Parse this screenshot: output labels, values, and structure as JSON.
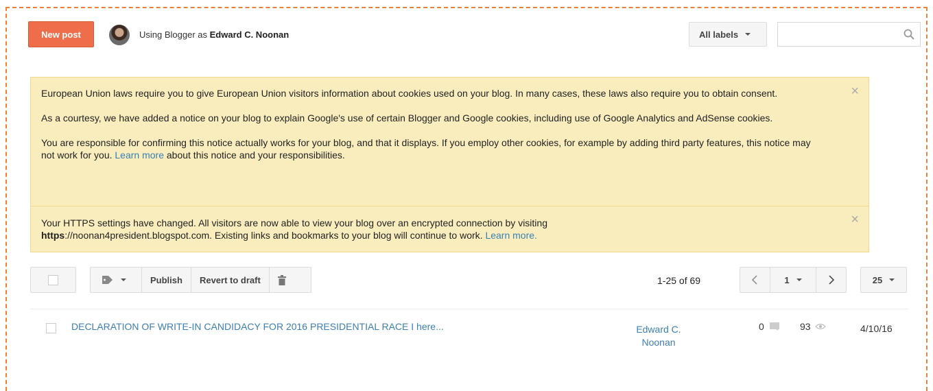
{
  "header": {
    "new_post_label": "New post",
    "using_prefix": "Using Blogger as",
    "user_name": "Edward C. Noonan",
    "labels_dropdown": "All labels",
    "search_placeholder": ""
  },
  "notices": {
    "eu": {
      "p1": "European Union laws require you to give European Union visitors information about cookies used on your blog. In many cases, these laws also require you to obtain consent.",
      "p2": "As a courtesy, we have added a notice on your blog to explain Google's use of certain Blogger and Google cookies, including use of Google Analytics and AdSense cookies.",
      "p3_before": "You are responsible for confirming this notice actually works for your blog, and that it displays. If you employ other cookies, for example by adding third party features, this notice may not work for you.",
      "p3_link": "Learn more",
      "p3_after": "about this notice and your responsibilities."
    },
    "https": {
      "text_before": "Your HTTPS settings have changed. All visitors are now able to view your blog over an encrypted connection by visiting",
      "https_bold": "https",
      "url_rest": "://noonan4president.blogspot.com. Existing links and bookmarks to your blog will continue to work.",
      "link": "Learn more."
    },
    "close_glyph": "×"
  },
  "toolbar": {
    "publish_label": "Publish",
    "revert_label": "Revert to draft",
    "range_text": "1-25 of 69",
    "page_number": "1",
    "per_page": "25"
  },
  "posts": [
    {
      "title": "DECLARATION OF WRITE-IN CANDIDACY FOR 2016 PRESIDENTIAL RACE I here...",
      "author_line1": "Edward C.",
      "author_line2": "Noonan",
      "comments": "0",
      "views": "93",
      "date": "4/10/16"
    }
  ],
  "colors": {
    "accent_orange": "#ee6e4c",
    "notice_bg": "#f9edbe",
    "link_blue": "#3d7fae"
  }
}
